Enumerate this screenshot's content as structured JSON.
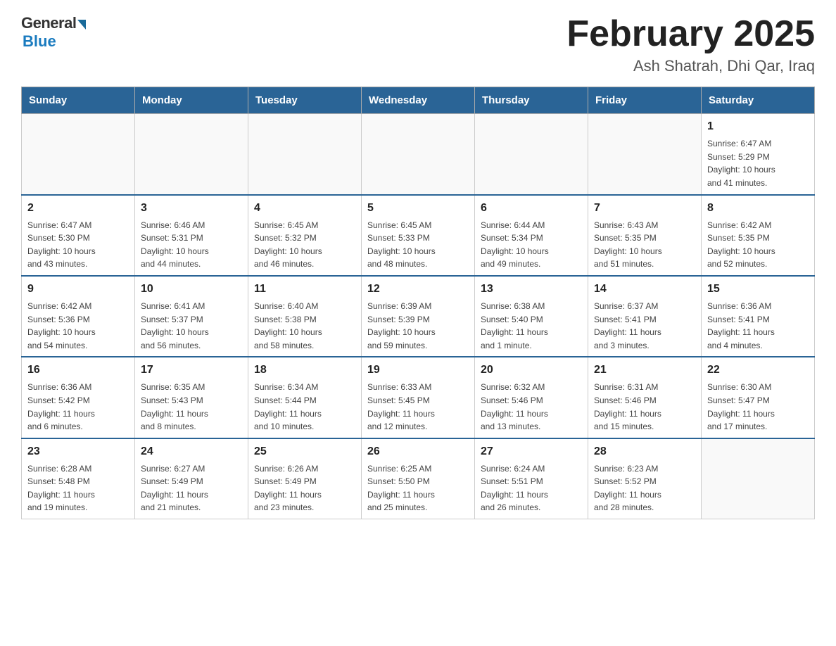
{
  "header": {
    "logo_general": "General",
    "logo_blue": "Blue",
    "title": "February 2025",
    "location": "Ash Shatrah, Dhi Qar, Iraq"
  },
  "weekdays": [
    "Sunday",
    "Monday",
    "Tuesday",
    "Wednesday",
    "Thursday",
    "Friday",
    "Saturday"
  ],
  "weeks": [
    [
      {
        "day": "",
        "info": ""
      },
      {
        "day": "",
        "info": ""
      },
      {
        "day": "",
        "info": ""
      },
      {
        "day": "",
        "info": ""
      },
      {
        "day": "",
        "info": ""
      },
      {
        "day": "",
        "info": ""
      },
      {
        "day": "1",
        "info": "Sunrise: 6:47 AM\nSunset: 5:29 PM\nDaylight: 10 hours\nand 41 minutes."
      }
    ],
    [
      {
        "day": "2",
        "info": "Sunrise: 6:47 AM\nSunset: 5:30 PM\nDaylight: 10 hours\nand 43 minutes."
      },
      {
        "day": "3",
        "info": "Sunrise: 6:46 AM\nSunset: 5:31 PM\nDaylight: 10 hours\nand 44 minutes."
      },
      {
        "day": "4",
        "info": "Sunrise: 6:45 AM\nSunset: 5:32 PM\nDaylight: 10 hours\nand 46 minutes."
      },
      {
        "day": "5",
        "info": "Sunrise: 6:45 AM\nSunset: 5:33 PM\nDaylight: 10 hours\nand 48 minutes."
      },
      {
        "day": "6",
        "info": "Sunrise: 6:44 AM\nSunset: 5:34 PM\nDaylight: 10 hours\nand 49 minutes."
      },
      {
        "day": "7",
        "info": "Sunrise: 6:43 AM\nSunset: 5:35 PM\nDaylight: 10 hours\nand 51 minutes."
      },
      {
        "day": "8",
        "info": "Sunrise: 6:42 AM\nSunset: 5:35 PM\nDaylight: 10 hours\nand 52 minutes."
      }
    ],
    [
      {
        "day": "9",
        "info": "Sunrise: 6:42 AM\nSunset: 5:36 PM\nDaylight: 10 hours\nand 54 minutes."
      },
      {
        "day": "10",
        "info": "Sunrise: 6:41 AM\nSunset: 5:37 PM\nDaylight: 10 hours\nand 56 minutes."
      },
      {
        "day": "11",
        "info": "Sunrise: 6:40 AM\nSunset: 5:38 PM\nDaylight: 10 hours\nand 58 minutes."
      },
      {
        "day": "12",
        "info": "Sunrise: 6:39 AM\nSunset: 5:39 PM\nDaylight: 10 hours\nand 59 minutes."
      },
      {
        "day": "13",
        "info": "Sunrise: 6:38 AM\nSunset: 5:40 PM\nDaylight: 11 hours\nand 1 minute."
      },
      {
        "day": "14",
        "info": "Sunrise: 6:37 AM\nSunset: 5:41 PM\nDaylight: 11 hours\nand 3 minutes."
      },
      {
        "day": "15",
        "info": "Sunrise: 6:36 AM\nSunset: 5:41 PM\nDaylight: 11 hours\nand 4 minutes."
      }
    ],
    [
      {
        "day": "16",
        "info": "Sunrise: 6:36 AM\nSunset: 5:42 PM\nDaylight: 11 hours\nand 6 minutes."
      },
      {
        "day": "17",
        "info": "Sunrise: 6:35 AM\nSunset: 5:43 PM\nDaylight: 11 hours\nand 8 minutes."
      },
      {
        "day": "18",
        "info": "Sunrise: 6:34 AM\nSunset: 5:44 PM\nDaylight: 11 hours\nand 10 minutes."
      },
      {
        "day": "19",
        "info": "Sunrise: 6:33 AM\nSunset: 5:45 PM\nDaylight: 11 hours\nand 12 minutes."
      },
      {
        "day": "20",
        "info": "Sunrise: 6:32 AM\nSunset: 5:46 PM\nDaylight: 11 hours\nand 13 minutes."
      },
      {
        "day": "21",
        "info": "Sunrise: 6:31 AM\nSunset: 5:46 PM\nDaylight: 11 hours\nand 15 minutes."
      },
      {
        "day": "22",
        "info": "Sunrise: 6:30 AM\nSunset: 5:47 PM\nDaylight: 11 hours\nand 17 minutes."
      }
    ],
    [
      {
        "day": "23",
        "info": "Sunrise: 6:28 AM\nSunset: 5:48 PM\nDaylight: 11 hours\nand 19 minutes."
      },
      {
        "day": "24",
        "info": "Sunrise: 6:27 AM\nSunset: 5:49 PM\nDaylight: 11 hours\nand 21 minutes."
      },
      {
        "day": "25",
        "info": "Sunrise: 6:26 AM\nSunset: 5:49 PM\nDaylight: 11 hours\nand 23 minutes."
      },
      {
        "day": "26",
        "info": "Sunrise: 6:25 AM\nSunset: 5:50 PM\nDaylight: 11 hours\nand 25 minutes."
      },
      {
        "day": "27",
        "info": "Sunrise: 6:24 AM\nSunset: 5:51 PM\nDaylight: 11 hours\nand 26 minutes."
      },
      {
        "day": "28",
        "info": "Sunrise: 6:23 AM\nSunset: 5:52 PM\nDaylight: 11 hours\nand 28 minutes."
      },
      {
        "day": "",
        "info": ""
      }
    ]
  ]
}
